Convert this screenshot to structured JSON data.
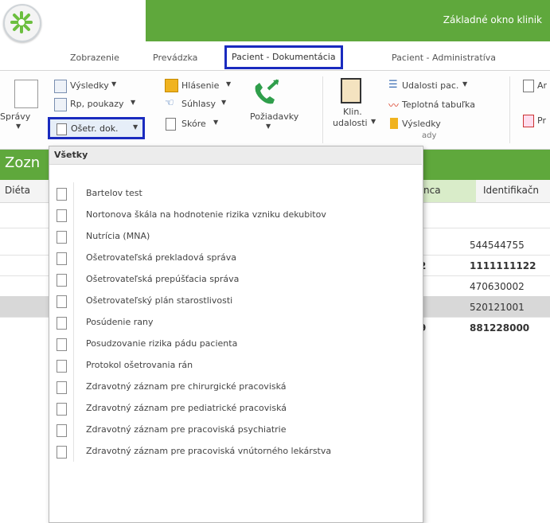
{
  "window": {
    "title": "Základné okno klinik"
  },
  "colors": {
    "brand_green": "#5fa83c",
    "highlight_blue": "#1a2bbf",
    "header_highlight": "#d9ecc9"
  },
  "tabs": [
    {
      "label": "Zobrazenie"
    },
    {
      "label": "Prevádzka"
    },
    {
      "label": "Pacient - Dokumentácia",
      "selected": true
    },
    {
      "label": "Pacient - Administratíva"
    }
  ],
  "ribbon": {
    "spravy": "Správy",
    "vysledky": "Výsledky",
    "rp_poukazy": "Rp, poukazy",
    "oset_dok": "Ošetr. dok.",
    "hlasenie": "Hlásenie",
    "suhlasy": "Súhlasy",
    "skore": "Skóre",
    "poziadavky": "Požiadavky",
    "klin": "Klin.",
    "udalosti": "udalosti",
    "udalosti_pac": "Udalosti pac.",
    "teplotna": "Teplotná tabuľka",
    "vysledky2": "Výsledky",
    "group_fragment": "ady",
    "an_fragment": "Ar",
    "pr_fragment": "Pr"
  },
  "section": {
    "title": "Zozn"
  },
  "table": {
    "headers": {
      "dieta": "Diéta",
      "mid": "nca",
      "id": "Identifikačn"
    },
    "rows": [
      {
        "mark": "",
        "id": "544544755",
        "bold": false
      },
      {
        "mark": "2",
        "id": "1111111122",
        "bold": true
      },
      {
        "mark": "",
        "id": "470630002",
        "bold": false
      },
      {
        "mark": "",
        "id": "520121001",
        "bold": false
      },
      {
        "mark": "9",
        "id": "881228000",
        "bold": true
      }
    ]
  },
  "dropdown": {
    "header": "Všetky",
    "items": [
      "Bartelov test",
      "Nortonova škála na hodnotenie rizika vzniku dekubitov",
      "Nutrícia (MNA)",
      "Ošetrovateľská prekladová správa",
      "Ošetrovateľská prepúšťacia správa",
      "Ošetrovateľský plán starostlivosti",
      "Posúdenie rany",
      "Posudzovanie rizika pádu pacienta",
      "Protokol ošetrovania rán",
      "Zdravotný záznam pre chirurgické pracoviská",
      "Zdravotný záznam pre pediatrické pracoviská",
      "Zdravotný záznam pre pracoviská psychiatrie",
      "Zdravotný záznam pre pracoviská vnútorného lekárstva"
    ]
  }
}
